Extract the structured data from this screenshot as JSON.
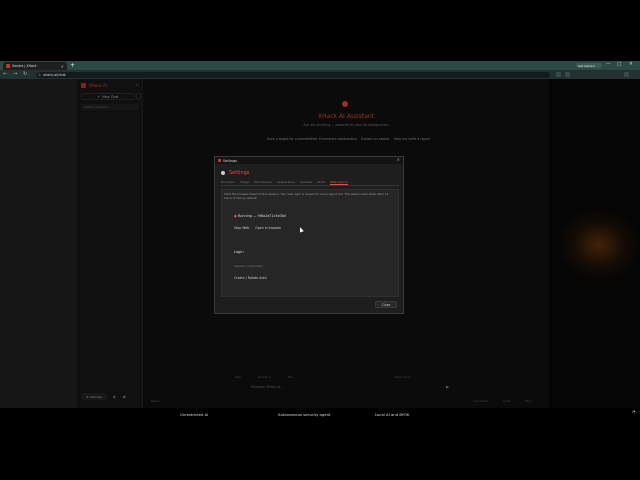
{
  "browser": {
    "tab_title": "Sandra | XHack",
    "new_tab": "+",
    "url": "xhack.ai/chat",
    "profile": "Ask Gemini",
    "minimize": "—",
    "maximize": "□",
    "close": "✕"
  },
  "sidebar": {
    "brand": "XHack AI",
    "new_chat": "New Chat",
    "search_placeholder": "Search sessions",
    "settings": "Settings"
  },
  "main": {
    "title": "XHack AI Assistant",
    "subtitle": "Ask me anything — powered by your AI configuration",
    "chips": [
      "Scan a target for vulnerabilities",
      "Enumerate subdomains",
      "Explain an exploit",
      "Help me write a report"
    ],
    "input_tabs": [
      "Web",
      "Research",
      "Plan",
      "Deep Think"
    ],
    "message_placeholder": "Message XHack AI...",
    "status": "Ready",
    "status_right": [
      "Connected",
      "Local",
      "Beta"
    ]
  },
  "modal": {
    "window_title": "Settings",
    "heading": "Settings",
    "tabs": [
      "Providers",
      "Usage",
      "Permissions",
      "Appearance",
      "Updates",
      "Skills",
      "Web Search"
    ],
    "description": "Start the browser-based XHack session. Your web login is reused for every agent call. The session auto-stops after 12 hours of idle by default.",
    "status": "Running — 9f8a2d71c5e3b0",
    "btn_stop": "Stop Web",
    "btn_open": "Open in browser",
    "login_heading": "Login",
    "field_placeholder": "Session credentials",
    "create_button": "Create / Rotate Auth",
    "close": "Close"
  },
  "features": [
    "Unrestricted AI",
    "Autonomous security agent",
    "Local AI and BYOK"
  ],
  "colors": {
    "accent": "#e74c3c",
    "tabstrip": "#2b4a45"
  },
  "icons": [
    "shield-icon",
    "close-icon",
    "gear-icon",
    "send-icon",
    "lock-icon"
  ]
}
